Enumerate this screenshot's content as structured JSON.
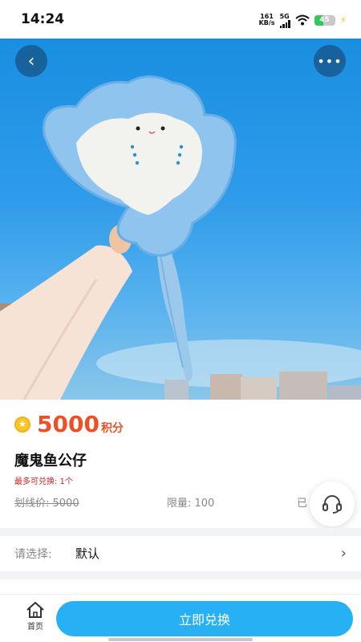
{
  "status_bar": {
    "time": "14:24",
    "net_speed_value": "161",
    "net_speed_unit": "KB/s",
    "network": "5G",
    "battery": "45"
  },
  "header": {
    "back_icon": "chevron-left-icon",
    "more_icon": "more-dots-icon"
  },
  "product": {
    "price_value": "5000",
    "price_unit": "积分",
    "name": "魔鬼鱼公仔",
    "exchange_limit": "最多可兑换: 1个",
    "original_price": "划线价: 5000",
    "purchase_limit": "限量: 100",
    "sold_prefix": "已"
  },
  "selection": {
    "label": "请选择:",
    "value": "默认"
  },
  "bottom_bar": {
    "home_label": "首页",
    "exchange_button": "立即兑换"
  },
  "colors": {
    "accent_blue": "#27b0f4",
    "price_red": "#f04e23",
    "limit_red": "#d42020"
  }
}
